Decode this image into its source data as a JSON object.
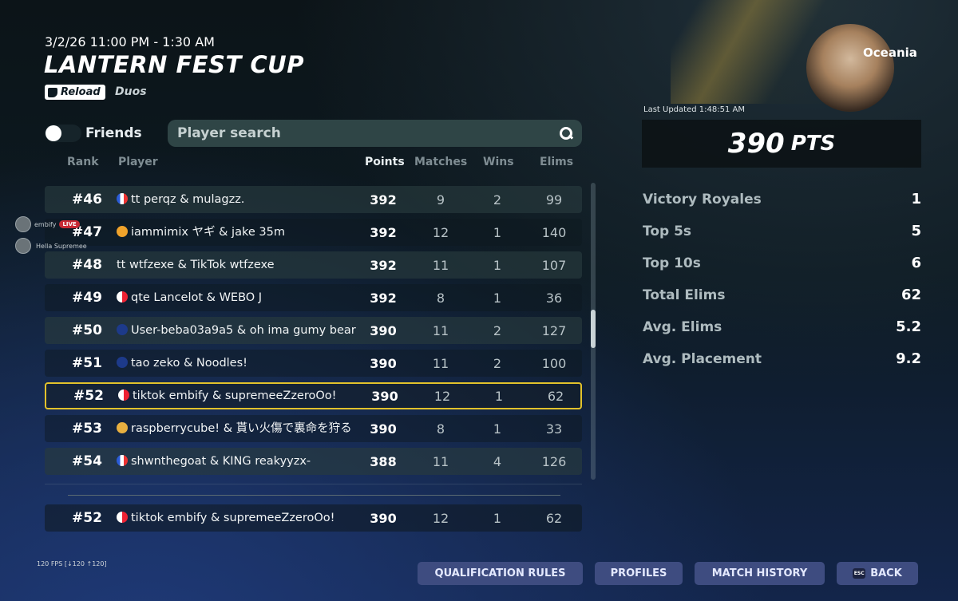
{
  "event": {
    "datetime": "3/2/26 11:00 PM - 1:30 AM",
    "title": "LANTERN FEST CUP",
    "mode": "Reload",
    "team_type": "Duos"
  },
  "filters": {
    "friends_label": "Friends",
    "search_placeholder": "Player search"
  },
  "columns": {
    "rank": "Rank",
    "player": "Player",
    "points": "Points",
    "matches": "Matches",
    "wins": "Wins",
    "elims": "Elims"
  },
  "rows": [
    {
      "rank": "#46",
      "player": "tt perqz & mulagzz.",
      "points": "392",
      "matches": "9",
      "wins": "2",
      "elims": "99"
    },
    {
      "rank": "#47",
      "player": "iammimix ヤギ & jake 35m",
      "points": "392",
      "matches": "12",
      "wins": "1",
      "elims": "140"
    },
    {
      "rank": "#48",
      "player": "tt wtfzexe & TikTok wtfzexe",
      "points": "392",
      "matches": "11",
      "wins": "1",
      "elims": "107"
    },
    {
      "rank": "#49",
      "player": "qte Lancelot & WEBO J",
      "points": "392",
      "matches": "8",
      "wins": "1",
      "elims": "36"
    },
    {
      "rank": "#50",
      "player": "User-beba03a9a5 & oh ima gumy bear",
      "points": "390",
      "matches": "11",
      "wins": "2",
      "elims": "127"
    },
    {
      "rank": "#51",
      "player": "tao zeko & Noodles!",
      "points": "390",
      "matches": "11",
      "wins": "2",
      "elims": "100"
    },
    {
      "rank": "#52",
      "player": "tiktok embify & supremeeZzeroOo!",
      "points": "390",
      "matches": "12",
      "wins": "1",
      "elims": "62"
    },
    {
      "rank": "#53",
      "player": "raspberrycube! & 貰い火傷で裏命を狩る",
      "points": "390",
      "matches": "8",
      "wins": "1",
      "elims": "33"
    },
    {
      "rank": "#54",
      "player": "shwnthegoat & KING reakyyzx-",
      "points": "388",
      "matches": "11",
      "wins": "4",
      "elims": "126"
    }
  ],
  "my_row": {
    "rank": "#52",
    "player": "tiktok embify & supremeeZzeroOo!",
    "points": "390",
    "matches": "12",
    "wins": "1",
    "elims": "62"
  },
  "overlay": {
    "streamer": "embify",
    "live": "LIVE",
    "second": "Hella Supremee"
  },
  "summary": {
    "region": "Oceania",
    "last_updated": "Last Updated 1:48:51 AM",
    "points": "390",
    "points_unit": "PTS",
    "stats": [
      {
        "label": "Victory Royales",
        "value": "1"
      },
      {
        "label": "Top 5s",
        "value": "5"
      },
      {
        "label": "Top 10s",
        "value": "6"
      },
      {
        "label": "Total Elims",
        "value": "62"
      },
      {
        "label": "Avg. Elims",
        "value": "5.2"
      },
      {
        "label": "Avg. Placement",
        "value": "9.2"
      }
    ]
  },
  "footer": {
    "fps": "120 FPS [↓120 ↑120]",
    "buttons": {
      "qualification": "QUALIFICATION RULES",
      "profiles": "PROFILES",
      "match_history": "MATCH HISTORY",
      "back": "BACK",
      "back_key": "ESC"
    }
  },
  "colors": {
    "highlight": "#e2c22b",
    "button": "#3e4c80"
  }
}
